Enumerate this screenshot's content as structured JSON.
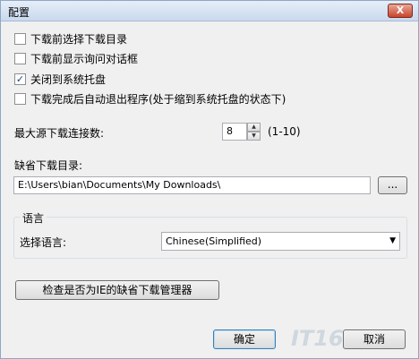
{
  "window": {
    "title": "配置",
    "close_glyph": "X"
  },
  "options": [
    {
      "label": "下载前选择下载目录",
      "checked": false
    },
    {
      "label": "下载前显示询问对话框",
      "checked": false
    },
    {
      "label": "关闭到系统托盘",
      "checked": true
    },
    {
      "label": "下载完成后自动退出程序(处于缩到系统托盘的状态下)",
      "checked": false
    }
  ],
  "connections": {
    "label": "最大源下载连接数:",
    "value": "8",
    "range": "(1-10)",
    "up_icon": "spin-up-icon",
    "down_icon": "spin-down-icon"
  },
  "download_dir": {
    "label": "缺省下载目录:",
    "value": "E:\\Users\\bian\\Documents\\My Downloads\\",
    "browse_label": "..."
  },
  "language": {
    "group_title": "语言",
    "label": "选择语言:",
    "selected": "Chinese(Simplified)",
    "arrow_icon": "dropdown-arrow-icon"
  },
  "buttons": {
    "check_ie": "检查是否为IE的缺省下载管理器",
    "ok": "确定",
    "cancel": "取消"
  },
  "watermark": {
    "text": "IT168"
  },
  "colors": {
    "window_bg": "#f0f0f0",
    "close_red": "#c8452c",
    "check_blue": "#1d3f86"
  }
}
